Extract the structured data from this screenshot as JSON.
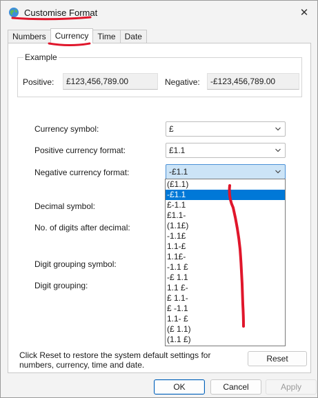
{
  "window": {
    "title": "Customise Format",
    "close_glyph": "✕"
  },
  "tabs": [
    {
      "label": "Numbers"
    },
    {
      "label": "Currency"
    },
    {
      "label": "Time"
    },
    {
      "label": "Date"
    }
  ],
  "example": {
    "legend": "Example",
    "positive_label": "Positive:",
    "positive_value": "£123,456,789.00",
    "negative_label": "Negative:",
    "negative_value": "-£123,456,789.00"
  },
  "fields": {
    "currency_symbol_label": "Currency symbol:",
    "currency_symbol_value": "£",
    "positive_format_label": "Positive currency format:",
    "positive_format_value": "£1.1",
    "negative_format_label": "Negative currency format:",
    "negative_format_value": "-£1.1",
    "decimal_symbol_label": "Decimal symbol:",
    "digits_after_decimal_label": "No. of digits after decimal:",
    "digit_grouping_symbol_label": "Digit grouping symbol:",
    "digit_grouping_label": "Digit grouping:"
  },
  "dropdown": {
    "options": [
      "(£1.1)",
      "-£1.1",
      "£-1.1",
      "£1.1-",
      "(1.1£)",
      "-1.1£",
      "1.1-£",
      "1.1£-",
      "-1.1 £",
      "-£ 1.1",
      "1.1 £-",
      "£ 1.1-",
      "£ -1.1",
      "1.1- £",
      "(£ 1.1)",
      "(1.1 £)"
    ],
    "selected_index": 1
  },
  "footer": {
    "note_line1": "Click Reset to restore the system default settings for",
    "note_line2": "numbers, currency, time and date.",
    "reset_label": "Reset",
    "ok_label": "OK",
    "cancel_label": "Cancel",
    "apply_label": "Apply"
  },
  "colors": {
    "selection": "#0078d7",
    "annotation": "#e0162b",
    "combo_open": "#cce4f7"
  },
  "icons": [
    "globe-icon",
    "close-icon",
    "chevron-down-icon"
  ]
}
